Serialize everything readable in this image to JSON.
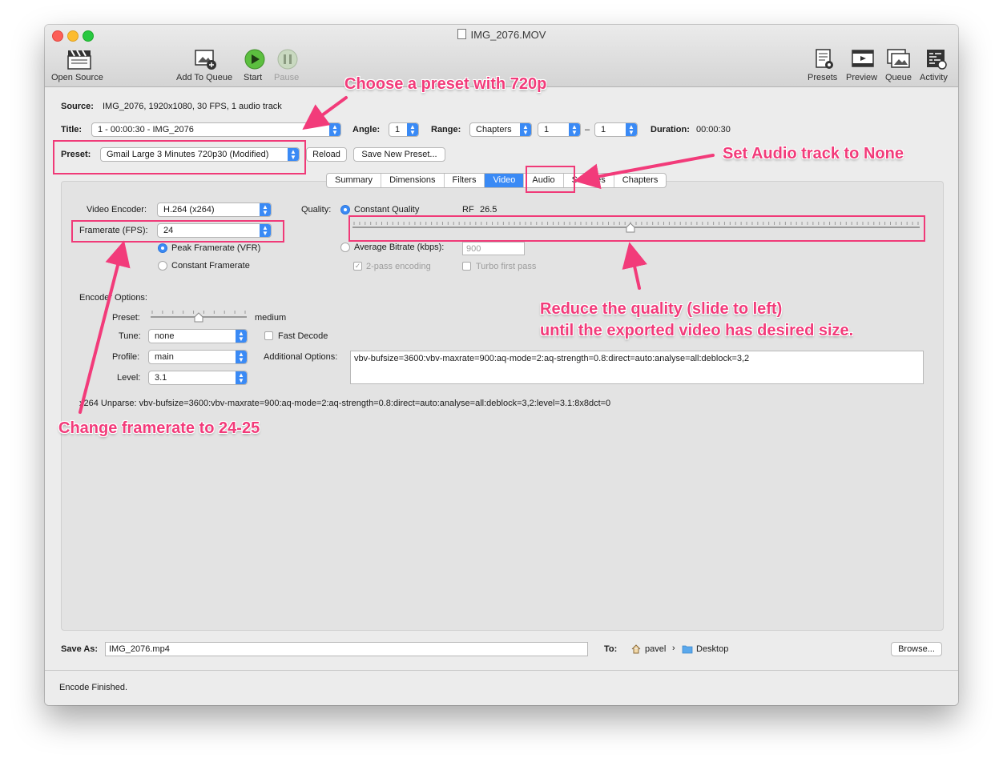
{
  "window": {
    "title": "IMG_2076.MOV"
  },
  "toolbar": {
    "open_source": "Open Source",
    "add_to_queue": "Add To Queue",
    "start": "Start",
    "pause": "Pause",
    "presets": "Presets",
    "preview": "Preview",
    "queue": "Queue",
    "activity": "Activity"
  },
  "source": {
    "label": "Source:",
    "value": "IMG_2076, 1920x1080, 30 FPS, 1 audio track"
  },
  "title_row": {
    "title_label": "Title:",
    "title_value": "1 - 00:00:30 - IMG_2076",
    "angle_label": "Angle:",
    "angle_value": "1",
    "range_label": "Range:",
    "range_type": "Chapters",
    "range_start": "1",
    "range_sep": "–",
    "range_end": "1",
    "duration_label": "Duration:",
    "duration_value": "00:00:30"
  },
  "preset_row": {
    "label": "Preset:",
    "value": "Gmail Large 3 Minutes 720p30 (Modified)",
    "reload": "Reload",
    "save_new": "Save New Preset..."
  },
  "tabs": [
    "Summary",
    "Dimensions",
    "Filters",
    "Video",
    "Audio",
    "Subtitles",
    "Chapters"
  ],
  "active_tab": "Video",
  "video": {
    "encoder_label": "Video Encoder:",
    "encoder_value": "H.264 (x264)",
    "framerate_label": "Framerate (FPS):",
    "framerate_value": "24",
    "peak_framerate": "Peak Framerate (VFR)",
    "constant_framerate": "Constant Framerate",
    "quality_label": "Quality:",
    "constant_quality": "Constant Quality",
    "rf_label": "RF",
    "rf_value": "26.5",
    "rf_slider_position": 0.49,
    "avg_bitrate_label": "Average Bitrate (kbps):",
    "avg_bitrate_value": "900",
    "two_pass": "2-pass encoding",
    "turbo": "Turbo first pass"
  },
  "encoder_options": {
    "heading": "Encoder Options:",
    "preset_label": "Preset:",
    "preset_value": "medium",
    "preset_slider_position": 0.5,
    "tune_label": "Tune:",
    "tune_value": "none",
    "fast_decode": "Fast Decode",
    "profile_label": "Profile:",
    "profile_value": "main",
    "level_label": "Level:",
    "level_value": "3.1",
    "additional_label": "Additional Options:",
    "additional_value": "vbv-bufsize=3600:vbv-maxrate=900:aq-mode=2:aq-strength=0.8:direct=auto:analyse=all:deblock=3,2",
    "unparse": "x264 Unparse: vbv-bufsize=3600:vbv-maxrate=900:aq-mode=2:aq-strength=0.8:direct=auto:analyse=all:deblock=3,2:level=3.1:8x8dct=0"
  },
  "save": {
    "label": "Save As:",
    "value": "IMG_2076.mp4",
    "to_label": "To:",
    "user": "pavel",
    "folder": "Desktop",
    "browse": "Browse..."
  },
  "status": "Encode Finished.",
  "annotations": {
    "preset": "Choose a preset with 720p",
    "audio": "Set Audio track to None",
    "quality_line1": "Reduce the quality (slide to left)",
    "quality_line2": "until the exported video has desired size.",
    "framerate": "Change framerate to 24-25"
  },
  "colors": {
    "accent": "#3a8af5",
    "annotation": "#f23b7a",
    "start_green": "#4caf3a"
  }
}
